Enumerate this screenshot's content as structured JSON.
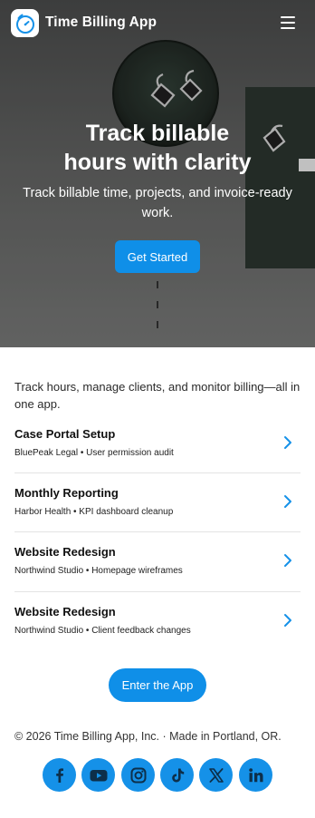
{
  "app": {
    "name": "Time Billing App"
  },
  "header": {
    "menu_icon": "hamburger-icon"
  },
  "hero": {
    "title_line1": "Track billable",
    "title_line2": "hours with clarity",
    "subtitle": "Track billable time, projects, and invoice-ready work.",
    "cta_label": "Get Started"
  },
  "intro": "Track hours, manage clients, and monitor billing—all in one app.",
  "projects": [
    {
      "title": "Case Portal Setup",
      "meta": "BluePeak Legal • User permission audit"
    },
    {
      "title": "Monthly Reporting",
      "meta": "Harbor Health • KPI dashboard cleanup"
    },
    {
      "title": "Website Redesign",
      "meta": "Northwind Studio • Homepage wireframes"
    },
    {
      "title": "Website Redesign",
      "meta": "Northwind Studio • Client feedback changes"
    }
  ],
  "enter_label": "Enter the App",
  "footer": {
    "copyright": "© 2026 Time Billing App, Inc. · Made in Portland, OR."
  },
  "socials": [
    "facebook-icon",
    "youtube-icon",
    "instagram-icon",
    "tiktok-icon",
    "x-icon",
    "linkedin-icon"
  ],
  "colors": {
    "accent": "#0f8fe8",
    "social_bg": "#1591e8",
    "text": "#1a1a1a"
  }
}
